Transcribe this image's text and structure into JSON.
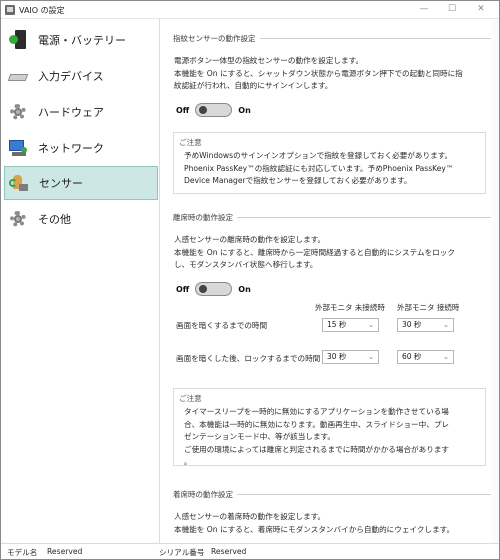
{
  "window": {
    "title": "VAIO の設定"
  },
  "sidebar": {
    "items": [
      {
        "label": "電源・バッテリー",
        "icon": "battery-icon"
      },
      {
        "label": "入力デバイス",
        "icon": "keyboard-icon"
      },
      {
        "label": "ハードウェア",
        "icon": "gear-icon"
      },
      {
        "label": "ネットワーク",
        "icon": "network-icon"
      },
      {
        "label": "センサー",
        "icon": "sensor-icon",
        "selected": true
      },
      {
        "label": "その他",
        "icon": "gear-icon"
      }
    ]
  },
  "fingerprint": {
    "heading": "指紋センサーの動作設定",
    "desc1": "電源ボタン一体型の指紋センサーの動作を設定します。",
    "desc2": "本機能を On にすると、シャットダウン状態から電源ボタン押下での起動と同時に指",
    "desc3": "紋認証が行われ、自動的にサインインします。",
    "toggle_off": "Off",
    "toggle_on": "On",
    "toggle_state": "off",
    "notice_title": "ご注意",
    "notice1": "予めWindowsのサインインオプションで指紋を登録しておく必要があります。",
    "notice2": "Phoenix PassKey™の指紋認証にも対応しています。予めPhoenix PassKey™",
    "notice3": "Device Managerで指紋センサーを登録しておく必要があります。"
  },
  "away": {
    "heading": "離席時の動作設定",
    "desc1": "人感センサーの離席時の動作を設定します。",
    "desc2": "本機能を On にすると、離席時から一定時間経過すると自動的にシステムをロック",
    "desc3": "し、モダンスタンバイ状態へ移行します。",
    "toggle_off": "Off",
    "toggle_on": "On",
    "toggle_state": "off",
    "col_unconnected": "外部モニタ 未接続時",
    "col_connected": "外部モニタ 接続時",
    "row1_label": "画面を暗くするまでの時間",
    "row1_unconnected": "15 秒",
    "row1_connected": "30 秒",
    "row2_label": "画面を暗くした後、ロックするまでの時間",
    "row2_unconnected": "30 秒",
    "row2_connected": "60 秒",
    "notice_title": "ご注意",
    "notice1": "タイマースリープを一時的に無効にするアプリケーションを動作させている場",
    "notice2": "合、本機能は一時的に無効になります。動画再生中、スライドショー中、プレ",
    "notice3": "ゼンテーションモード中、等が該当します。",
    "notice4": "ご使用の環境によっては離席と判定されるまでに時間がかかる場合があります",
    "notice5": "。"
  },
  "return": {
    "heading": "着席時の動作設定",
    "desc1": "人感センサーの着席時の動作を設定します。",
    "desc2": "本機能を On にすると、着席時にモダンスタンバイから自動的にウェイクします。"
  },
  "status": {
    "model_label": "モデル名",
    "model_value": "Reserved",
    "serial_label": "シリアル番号",
    "serial_value": "Reserved"
  }
}
